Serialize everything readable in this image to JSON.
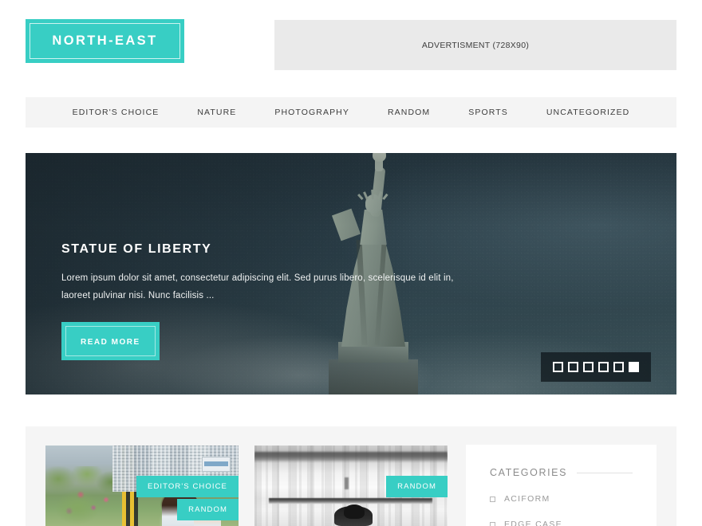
{
  "header": {
    "logo_text": "NORTH-EAST",
    "ad_text": "ADVERTISMENT (728X90)"
  },
  "nav": {
    "items": [
      {
        "label": "EDITOR'S CHOICE"
      },
      {
        "label": "NATURE"
      },
      {
        "label": "PHOTOGRAPHY"
      },
      {
        "label": "RANDOM"
      },
      {
        "label": "SPORTS"
      },
      {
        "label": "UNCATEGORIZED"
      }
    ]
  },
  "hero": {
    "title": "STATUE OF LIBERTY",
    "description": "Lorem ipsum dolor sit amet, consectetur adipiscing elit. Sed purus libero, scelerisque id elit in, laoreet pulvinar nisi. Nunc facilisis ...",
    "button_label": "READ MORE",
    "pager": {
      "count": 6,
      "active_index": 5
    }
  },
  "cards": [
    {
      "image_name": "city-family-photo",
      "badges": [
        "EDITOR'S CHOICE",
        "RANDOM"
      ]
    },
    {
      "image_name": "subway-motion-blur-photo",
      "badges": [
        "RANDOM"
      ]
    }
  ],
  "sidebar": {
    "widget_title": "CATEGORIES",
    "categories": [
      {
        "label": "ACIFORM"
      },
      {
        "label": "EDGE CASE"
      }
    ]
  },
  "colors": {
    "accent": "#38cec4",
    "nav_bg": "#f4f4f4",
    "ad_bg": "#eaeaea",
    "section_bg": "#f5f5f5",
    "hero_bg": "#2c3f49"
  }
}
